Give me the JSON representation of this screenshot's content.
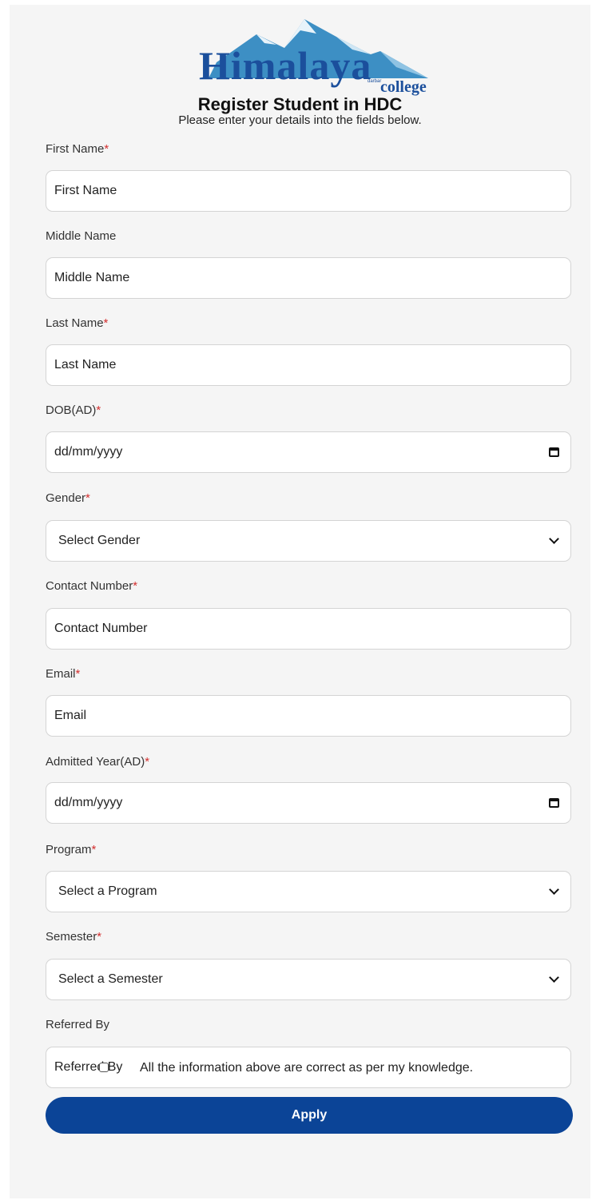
{
  "header": {
    "logo_main": "Himalaya",
    "logo_sub": "college",
    "logo_tiny": "darbar",
    "title": "Register Student in HDC",
    "subtitle": "Please enter your details into the fields below."
  },
  "form": {
    "first_name": {
      "label": "First Name",
      "required_mark": "*",
      "placeholder": "First Name"
    },
    "middle_name": {
      "label": "Middle Name",
      "placeholder": "Middle Name"
    },
    "last_name": {
      "label": "Last Name",
      "required_mark": "*",
      "placeholder": "Last Name"
    },
    "dob": {
      "label": "DOB(AD)",
      "required_mark": "*",
      "placeholder": "dd/mm/yyyy"
    },
    "gender": {
      "label": "Gender",
      "required_mark": "*",
      "selected": "Select Gender"
    },
    "contact": {
      "label": "Contact Number",
      "required_mark": "*",
      "placeholder": "Contact Number"
    },
    "email": {
      "label": "Email",
      "required_mark": "*",
      "placeholder": "Email"
    },
    "admitted_year": {
      "label": "Admitted Year(AD)",
      "required_mark": "*",
      "placeholder": "dd/mm/yyyy"
    },
    "program": {
      "label": "Program",
      "required_mark": "*",
      "selected": "Select a Program"
    },
    "semester": {
      "label": "Semester",
      "required_mark": "*",
      "selected": "Select a Semester"
    },
    "referred_by": {
      "label": "Referred By",
      "placeholder": "Referred By"
    },
    "consent": {
      "label": "All the information above are correct as per my knowledge.",
      "checked": false
    },
    "apply_label": "Apply"
  },
  "colors": {
    "primary_button": "#0b4497",
    "required_mark": "#d32f2f",
    "logo_text": "#1b4f9c",
    "logo_mountain": "#3d8fc4"
  },
  "icons": {
    "date_picker": "calendar-icon",
    "dropdown": "chevron-down-icon"
  }
}
